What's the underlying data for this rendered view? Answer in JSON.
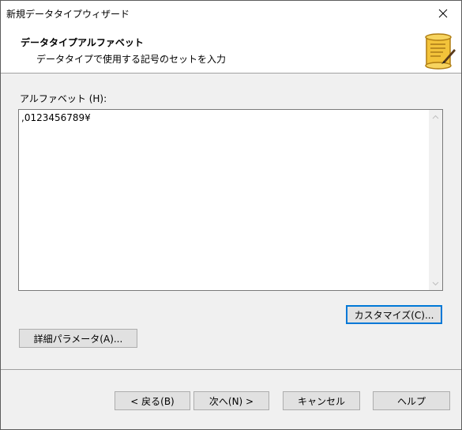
{
  "window": {
    "title": "新規データタイプウィザード",
    "close_glyph": "✕"
  },
  "header": {
    "title": "データタイプアルファベット",
    "subtitle": "データタイプで使用する記号のセットを入力",
    "icon": "scroll-quill-icon"
  },
  "alphabet": {
    "label": "アルファベット (H):",
    "value": ",0123456789¥"
  },
  "buttons": {
    "customize": "カスタマイズ(C)...",
    "advanced": "詳細パラメータ(A)...",
    "back": "< 戻る(B)",
    "next": "次へ(N) >",
    "cancel": "キャンセル",
    "help": "ヘルプ"
  },
  "colors": {
    "accent_focus": "#0078d7",
    "dialog_bg": "#f0f0f0",
    "header_bg": "#ffffff"
  }
}
